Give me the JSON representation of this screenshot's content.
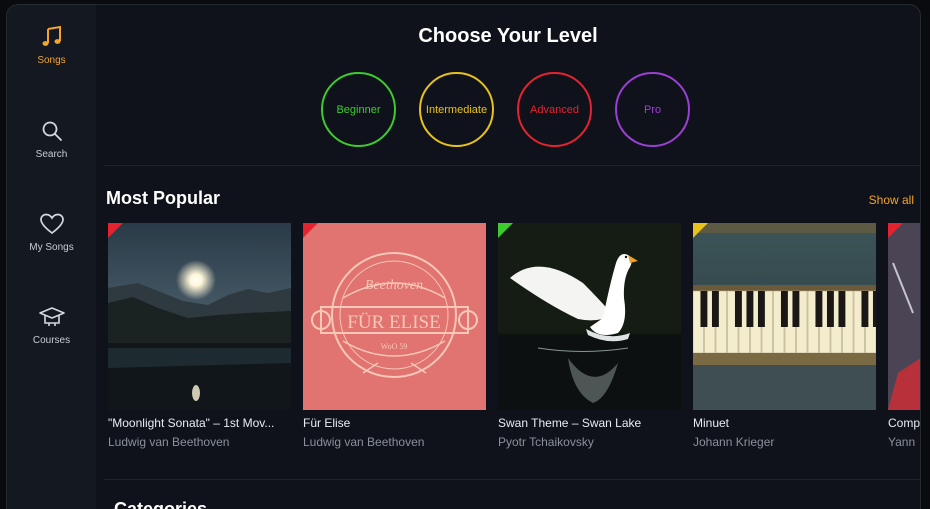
{
  "sidebar": {
    "items": [
      {
        "label": "Songs",
        "icon": "music-note-icon",
        "active": true
      },
      {
        "label": "Search",
        "icon": "search-icon",
        "active": false
      },
      {
        "label": "My Songs",
        "icon": "heart-icon",
        "active": false
      },
      {
        "label": "Courses",
        "icon": "graduation-cap-icon",
        "active": false
      }
    ]
  },
  "levels": {
    "title": "Choose Your Level",
    "items": [
      {
        "label": "Beginner",
        "color": "#3ecb2e"
      },
      {
        "label": "Intermediate",
        "color": "#e8c21c"
      },
      {
        "label": "Advanced",
        "color": "#e5232f"
      },
      {
        "label": "Pro",
        "color": "#9b3fd6"
      }
    ]
  },
  "popular": {
    "title": "Most Popular",
    "show_all": "Show all",
    "songs": [
      {
        "title": "\"Moonlight Sonata\" – 1st Mov...",
        "artist": "Ludwig van Beethoven",
        "level_color": "#e5232f",
        "thumbnail": "moonlit-lake"
      },
      {
        "title": "Für Elise",
        "artist": "Ludwig van Beethoven",
        "level_color": "#e5232f",
        "thumbnail": "fur-elise-emblem",
        "emblem_top": "Beethoven",
        "emblem_main": "FÜR ELISE",
        "emblem_small": "WoO 59"
      },
      {
        "title": "Swan Theme – Swan Lake",
        "artist": "Pyotr Tchaikovsky",
        "level_color": "#3ecb2e",
        "thumbnail": "swan"
      },
      {
        "title": "Minuet",
        "artist": "Johann Krieger",
        "level_color": "#e8c21c",
        "thumbnail": "piano-keys"
      },
      {
        "title": "Comp",
        "artist": "Yann",
        "level_color": "#e5232f",
        "thumbnail": "abstract"
      }
    ]
  },
  "categories": {
    "title": "Categories"
  },
  "colors": {
    "accent": "#f4a42a",
    "background": "#0f121a",
    "sidebar": "#141821"
  }
}
